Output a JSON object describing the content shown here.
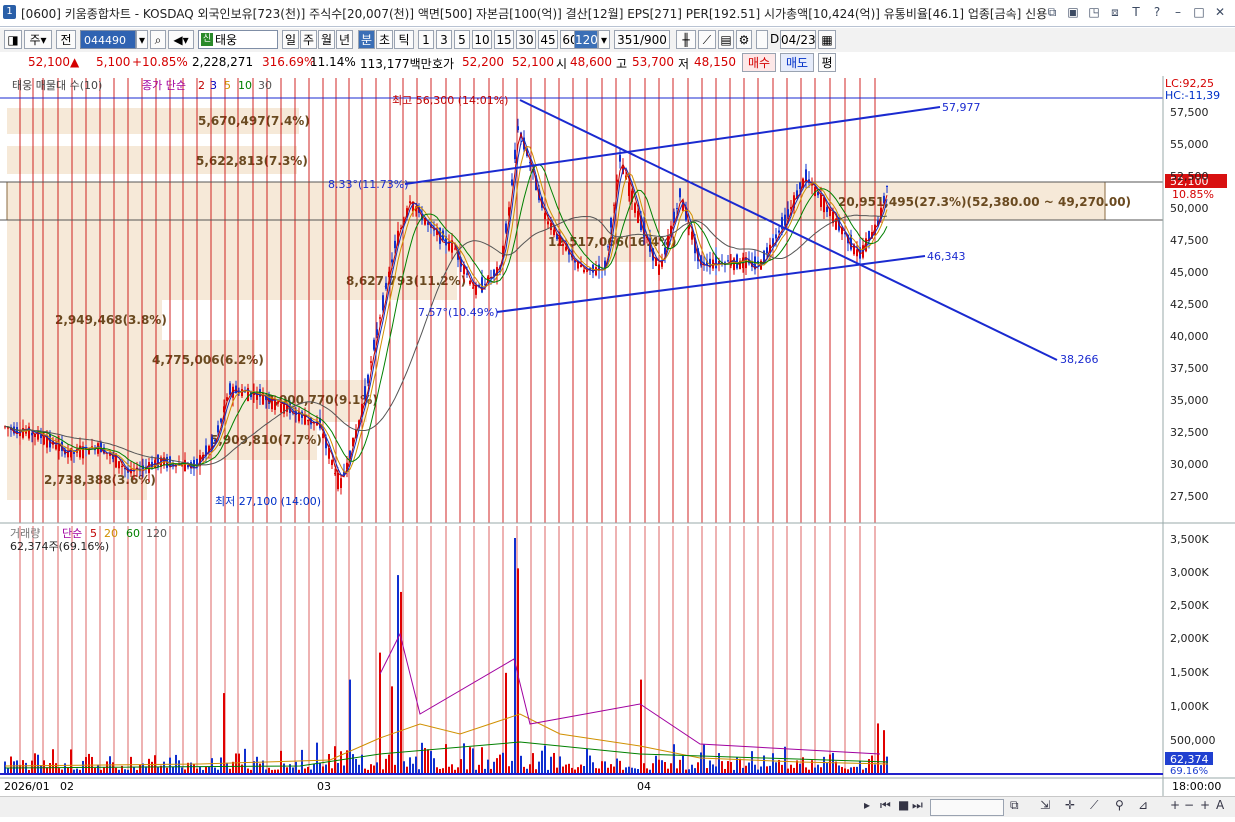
{
  "window": {
    "number": "1",
    "title": "[0600] 키움종합차트 - KOSDAQ 외국인보유[723(천)] 주식수[20,007(천)] 액면[500] 자본금[100(억)] 결산[12월] EPS[271] PER[192.51] 시가총액[10,424(억)] 유통비율[46.1] 업종[금속] 신용"
  },
  "toolbar": {
    "type_label": "주",
    "all_label": "전",
    "code": "044490",
    "stock_name": "태웅",
    "sin_badge": "신",
    "periods": [
      "일",
      "주",
      "월",
      "년",
      "분",
      "초",
      "틱"
    ],
    "selected_period": "분",
    "minutes": [
      "1",
      "3",
      "5",
      "10",
      "15",
      "30",
      "45",
      "60"
    ],
    "minute_value": "120",
    "count": "351/900",
    "date_checkbox_label": "D",
    "date": "04/23"
  },
  "quote": {
    "price": "52,100",
    "change": "5,100",
    "change_pct": "+10.85%",
    "volume": "2,228,271",
    "volume_ratio": "316.69%",
    "turnover": "11.14%",
    "amount": "113,177백만",
    "bid_label": "호가",
    "ask": "52,200",
    "bid": "52,100",
    "open_label": "시",
    "open": "48,600",
    "high_label": "고",
    "high": "53,700",
    "low_label": "저",
    "low": "48,150",
    "buy_label": "매수",
    "sell_label": "매도",
    "eval_label": "평"
  },
  "price_panel": {
    "legend_title": "태웅 매물대 수(10)",
    "ma_label": "종가 단순",
    "ma_periods": [
      "2",
      "3",
      "5",
      "10",
      "30"
    ],
    "lc": "LC:92,25",
    "hc": "HC:-11,39",
    "max_label": "최고 56,300 (14:01%)",
    "min_label": "최저 27,100 (14:00)",
    "current_price_tag": "52,100",
    "current_pct_tag": "10.85%",
    "y_ticks": [
      "57,500",
      "55,000",
      "52,500",
      "50,000",
      "47,500",
      "45,000",
      "42,500",
      "40,000",
      "37,500",
      "35,000",
      "32,500",
      "30,000",
      "27,500"
    ],
    "trend_labels": {
      "upper_right": "57,977",
      "upper_left": "8.33°(11.73%)",
      "lower_right": "46,343",
      "lower_left": "7.57°(10.49%)",
      "falling_right": "38,266"
    },
    "volume_profile": [
      {
        "label": "5,670,497(7.4%)"
      },
      {
        "label": "5,622,813(7.3%)"
      },
      {
        "label": "20,951,495(27.3%)(52,380.00 ~ 49,270.00)"
      },
      {
        "label": "12,517,066(16.4%)"
      },
      {
        "label": "8,627,793(11.2%)"
      },
      {
        "label": "2,949,468(3.8%)"
      },
      {
        "label": "4,775,006(6.2%)"
      },
      {
        "label": "7,000,770(9.1%)"
      },
      {
        "label": "5,909,810(7.7%)"
      },
      {
        "label": "2,738,388(3.6%)"
      }
    ]
  },
  "volume_panel": {
    "legend_title": "거래량",
    "ma_label": "단순",
    "ma_periods": [
      "5",
      "20",
      "60",
      "120"
    ],
    "last_volume": "62,374주(69.16%)",
    "y_ticks": [
      "3,500K",
      "3,000K",
      "2,500K",
      "2,000K",
      "1,500K",
      "1,000K",
      "500,000"
    ],
    "tag_volume": "62,374",
    "tag_pct": "69.16%"
  },
  "x_axis": {
    "labels": [
      "2026/01",
      "02",
      "03",
      "04"
    ],
    "right_time": "18:00:00"
  },
  "colors": {
    "up": "#e00000",
    "down": "#1030d0",
    "trendline": "#1a2ad0",
    "profile": "#f6e9d8",
    "vline": "#c80000"
  }
}
